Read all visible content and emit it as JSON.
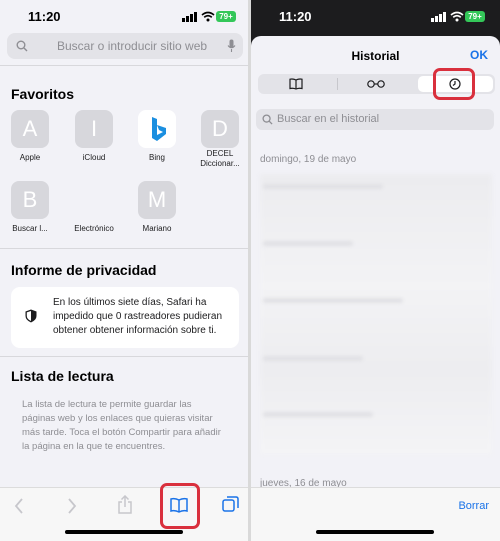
{
  "left": {
    "status": {
      "time": "11:20",
      "battery": "79+"
    },
    "search": {
      "placeholder": "Buscar o introducir sitio web"
    },
    "favorites": {
      "title": "Favoritos",
      "items": [
        {
          "letter": "A",
          "label": "Apple"
        },
        {
          "letter": "I",
          "label": "iCloud"
        },
        {
          "letter": "",
          "label": "Bing",
          "icon": "bing-logo-icon"
        },
        {
          "letter": "D",
          "label": "DECEL Diccionar..."
        },
        {
          "letter": "B",
          "label": "Buscar l..."
        },
        {
          "letter": "",
          "label": "Electrónico"
        },
        {
          "letter": "M",
          "label": "Mariano"
        }
      ]
    },
    "privacy": {
      "title": "Informe de privacidad",
      "text": "En los últimos siete días, Safari ha impedido que 0 rastreadores pudieran obtener obtener información sobre ti.",
      "icon": "shield-icon"
    },
    "reading": {
      "title": "Lista de lectura",
      "text": "La lista de lectura te permite guardar las páginas web y los enlaces que quieras visitar más tarde. Toca el botón Compartir para añadir la página en la que te encuentres."
    },
    "toolbar": {
      "icons": [
        "chevron-left-icon",
        "chevron-right-icon",
        "share-icon",
        "book-icon",
        "tabs-icon"
      ],
      "accent": "#d9303d"
    }
  },
  "right": {
    "status": {
      "time": "11:20",
      "battery": "79+"
    },
    "sheet": {
      "title": "Historial",
      "ok": "OK",
      "segments": [
        "book-icon",
        "glasses-icon",
        "clock-icon"
      ],
      "search_placeholder": "Buscar en el historial",
      "date_headers": [
        "domingo, 19 de mayo",
        "jueves, 16 de mayo"
      ],
      "clear": "Borrar"
    },
    "accent": "#1a73e8"
  }
}
